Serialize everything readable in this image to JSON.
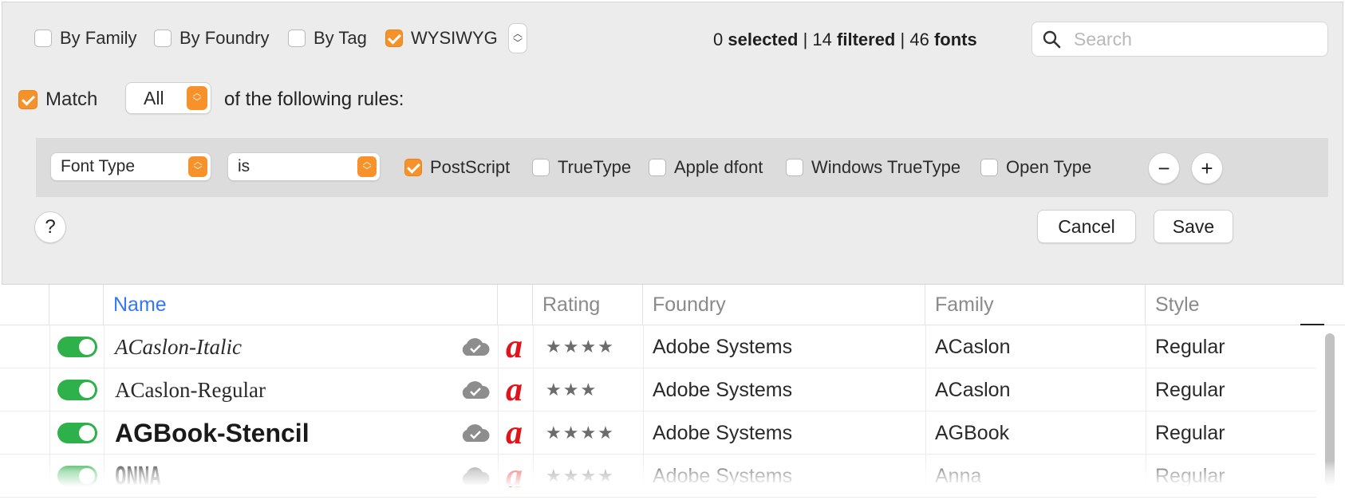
{
  "filters": {
    "by_family": {
      "label": "By Family",
      "checked": false
    },
    "by_foundry": {
      "label": "By Foundry",
      "checked": false
    },
    "by_tag": {
      "label": "By Tag",
      "checked": false
    },
    "wysiwyg": {
      "label": "WYSIWYG",
      "checked": true
    }
  },
  "counts": {
    "selected_num": "0",
    "selected_word": "selected",
    "filtered_num": "14",
    "filtered_word": "filtered",
    "fonts_num": "46",
    "fonts_word": "fonts",
    "sep": "|"
  },
  "search": {
    "placeholder": "Search"
  },
  "match": {
    "label": "Match",
    "checked": true,
    "mode": "All",
    "suffix": "of the following rules:"
  },
  "rule": {
    "field": "Font Type",
    "operator": "is",
    "options": [
      {
        "label": "PostScript",
        "checked": true
      },
      {
        "label": "TrueType",
        "checked": false
      },
      {
        "label": "Apple dfont",
        "checked": false
      },
      {
        "label": "Windows TrueType",
        "checked": false
      },
      {
        "label": "Open Type",
        "checked": false
      }
    ],
    "remove_symbol": "−",
    "add_symbol": "+"
  },
  "footer": {
    "help": "?",
    "cancel": "Cancel",
    "save": "Save"
  },
  "table": {
    "columns": {
      "name": "Name",
      "rating": "Rating",
      "foundry": "Foundry",
      "family": "Family",
      "style": "Style"
    },
    "rows": [
      {
        "name": "ACaslon-Italic",
        "rating": 4,
        "rating_text": "★★★★",
        "foundry": "Adobe Systems",
        "family": "ACaslon",
        "style": "Regular",
        "enabled": true,
        "glyph": "a"
      },
      {
        "name": "ACaslon-Regular",
        "rating": 3,
        "rating_text": "★★★",
        "foundry": "Adobe Systems",
        "family": "ACaslon",
        "style": "Regular",
        "enabled": true,
        "glyph": "a"
      },
      {
        "name": "AGBook-Stencil",
        "rating": 4,
        "rating_text": "★★★★",
        "foundry": "Adobe Systems",
        "family": "AGBook",
        "style": "Regular",
        "enabled": true,
        "glyph": "a"
      },
      {
        "name": "ONNA",
        "rating": 4,
        "rating_text": "★★★★",
        "foundry": "Adobe Systems",
        "family": "Anna",
        "style": "Regular",
        "enabled": true,
        "glyph": "a"
      }
    ]
  },
  "colors": {
    "accent": "#f7922a",
    "toggle_on": "#2eb04a",
    "link_header": "#3478f6",
    "adobe_red": "#e0141b"
  }
}
